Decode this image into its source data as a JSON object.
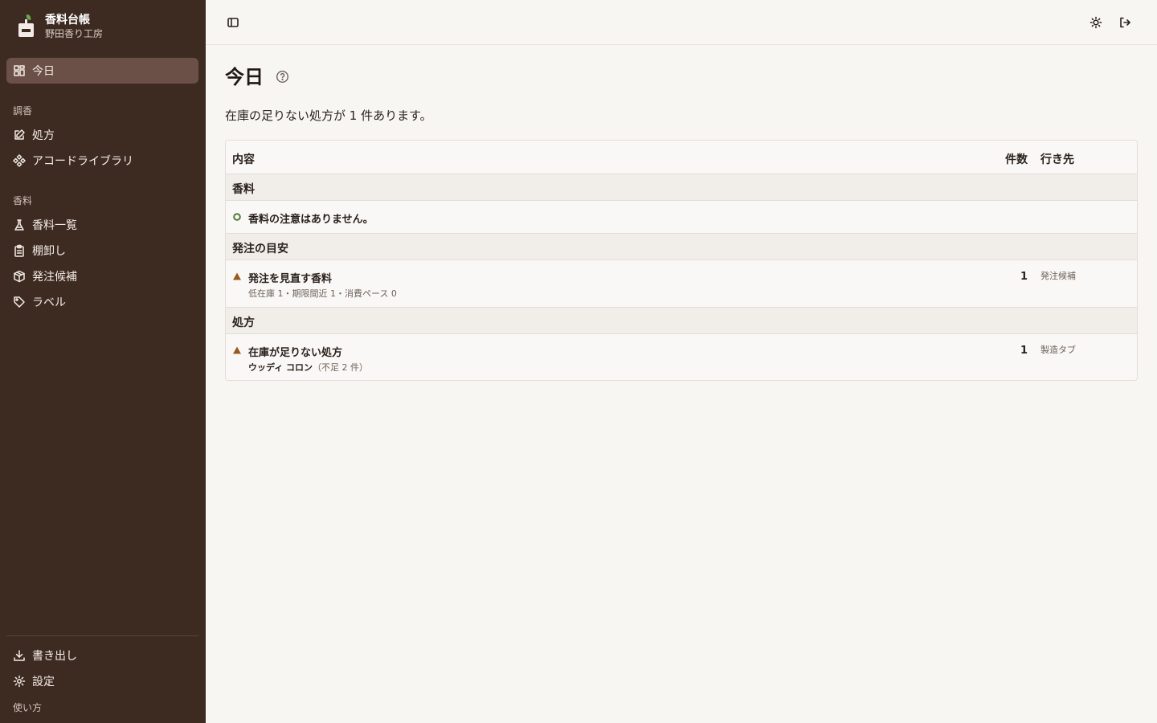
{
  "app": {
    "title": "香料台帳",
    "subtitle": "野田香り工房"
  },
  "sidebar": {
    "today": "今日",
    "sections": [
      {
        "label": "調香",
        "items": [
          {
            "label": "処方",
            "icon": "edit-icon"
          },
          {
            "label": "アコードライブラリ",
            "icon": "accord-icon"
          }
        ]
      },
      {
        "label": "香料",
        "items": [
          {
            "label": "香料一覧",
            "icon": "flask-icon"
          },
          {
            "label": "棚卸し",
            "icon": "clipboard-icon"
          },
          {
            "label": "発注候補",
            "icon": "package-icon"
          },
          {
            "label": "ラベル",
            "icon": "tag-icon"
          }
        ]
      }
    ],
    "footer": {
      "export": "書き出し",
      "settings": "設定",
      "help": "使い方"
    }
  },
  "topbar": {
    "toggle_icon": "sidebar-toggle-icon",
    "theme_icon": "sun-icon",
    "logout_icon": "logout-icon"
  },
  "main": {
    "title": "今日",
    "summary": "在庫の足りない処方が 1 件あります。"
  },
  "table": {
    "headers": {
      "content": "内容",
      "count": "件数",
      "destination": "行き先"
    },
    "groups": [
      {
        "label": "香料",
        "rows": [
          {
            "status": "ok",
            "title": "香料の注意はありません。",
            "subtitle": "",
            "count": "",
            "destination": ""
          }
        ]
      },
      {
        "label": "発注の目安",
        "rows": [
          {
            "status": "warning",
            "title": "発注を見直す香料",
            "subtitle": "低在庫 1・期限間近 1・消費ペース 0",
            "count": "1",
            "destination": "発注候補"
          }
        ]
      },
      {
        "label": "処方",
        "rows": [
          {
            "status": "warning",
            "title": "在庫が足りない処方",
            "subtitle_strong": "ウッディ コロン",
            "subtitle": "（不足 2 件）",
            "count": "1",
            "destination": "製造タブ"
          }
        ]
      }
    ]
  },
  "colors": {
    "sidebar_bg": "#3d2b22",
    "active_bg": "#6b5047",
    "warning": "#9a5a1e",
    "ok": "#4d7a3c",
    "logo_leaf": "#6aa84f"
  }
}
